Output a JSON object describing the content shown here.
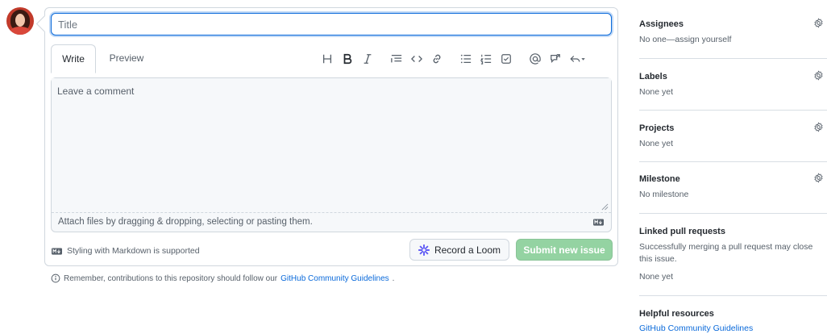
{
  "issue_form": {
    "title_placeholder": "Title",
    "tabs": {
      "write": "Write",
      "preview": "Preview"
    },
    "comment_placeholder": "Leave a comment",
    "attach_text": "Attach files by dragging & dropping, selecting or pasting them.",
    "markdown_note": "Styling with Markdown is supported",
    "loom_label": "Record a Loom",
    "submit_label": "Submit new issue",
    "guidelines_prefix": "Remember, contributions to this repository should follow our ",
    "guidelines_link": "GitHub Community Guidelines",
    "guidelines_suffix": "."
  },
  "toolbar_icons": [
    "heading-icon",
    "bold-icon",
    "italic-icon",
    "quote-icon",
    "code-icon",
    "link-icon",
    "bulleted-list-icon",
    "numbered-list-icon",
    "task-list-icon",
    "mention-icon",
    "reference-icon",
    "saved-reply-icon"
  ],
  "sidebar": {
    "assignees": {
      "heading": "Assignees",
      "value": "No one—assign yourself"
    },
    "labels": {
      "heading": "Labels",
      "value": "None yet"
    },
    "projects": {
      "heading": "Projects",
      "value": "None yet"
    },
    "milestone": {
      "heading": "Milestone",
      "value": "No milestone"
    },
    "linked_prs": {
      "heading": "Linked pull requests",
      "value": "Successfully merging a pull request may close this issue.",
      "value2": "None yet"
    },
    "helpful": {
      "heading": "Helpful resources",
      "link": "GitHub Community Guidelines"
    }
  },
  "colors": {
    "accent": "#0969da",
    "submit_disabled": "#94d3a2",
    "muted": "#57606a"
  }
}
